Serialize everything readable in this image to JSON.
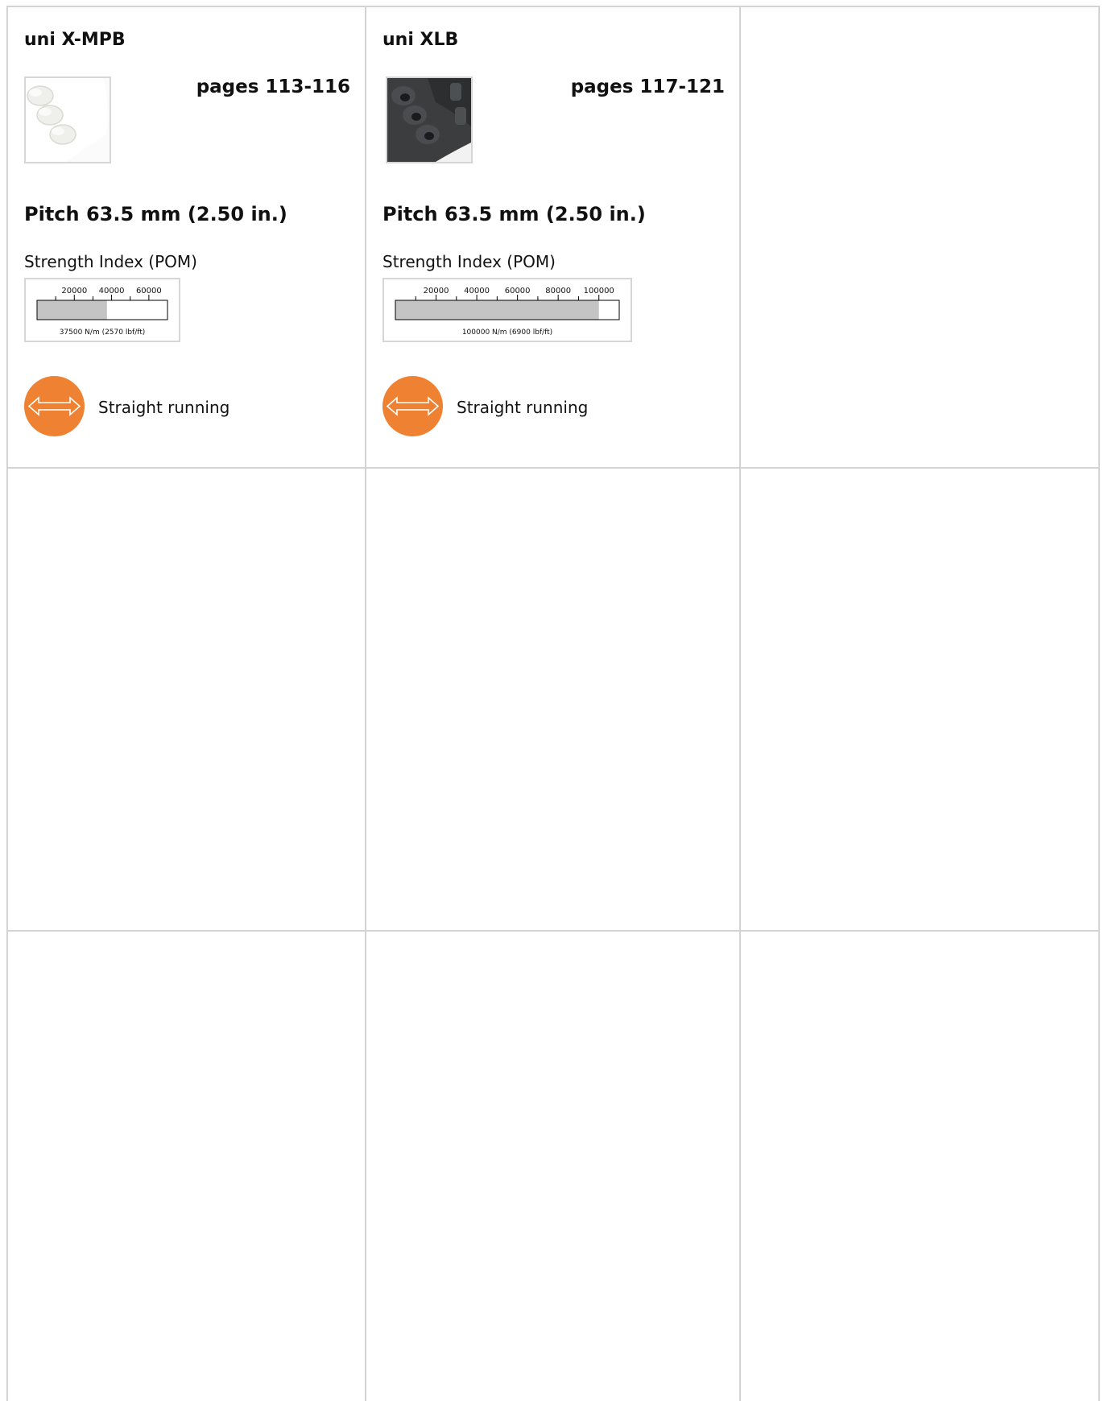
{
  "cards": [
    {
      "title": "uni X-MPB",
      "pages": "pages 113-116",
      "pitch": "Pitch 63.5 mm (2.50 in.)",
      "strength_label": "Strength Index (POM)",
      "strength": {
        "ticks": [
          "20000",
          "40000",
          "60000"
        ],
        "value": 37500,
        "caption": "37500 N/m (2570 lbf/ft)"
      },
      "direction": {
        "icon": "double-arrow-icon",
        "label": "Straight running"
      },
      "thumb": "white-belt-image"
    },
    {
      "title": "uni XLB",
      "pages": "pages 117-121",
      "pitch": "Pitch 63.5 mm (2.50 in.)",
      "strength_label": "Strength Index (POM)",
      "strength": {
        "ticks": [
          "20000",
          "40000",
          "60000",
          "80000",
          "100000"
        ],
        "value": 100000,
        "caption": "100000 N/m (6900 lbf/ft)"
      },
      "direction": {
        "icon": "double-arrow-icon",
        "label": "Straight running"
      },
      "thumb": "black-belt-image"
    }
  ],
  "colors": {
    "accent": "#ef8232",
    "grid": "#d3d3d3",
    "bar": "#c4c4c4"
  }
}
